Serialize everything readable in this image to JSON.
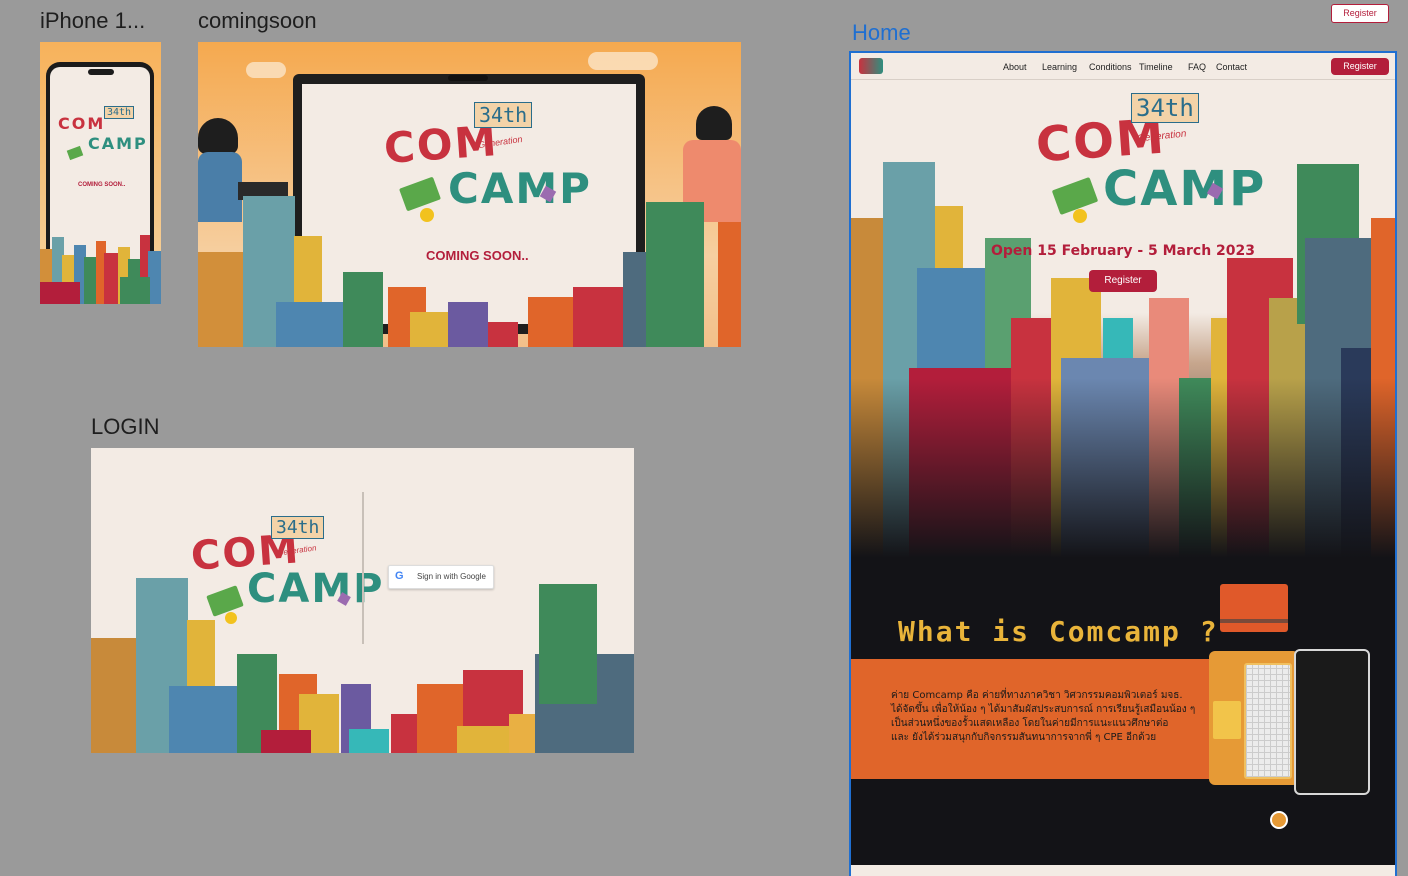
{
  "frames": {
    "iphone_label": "iPhone 1...",
    "comingsoon_label": "comingsoon",
    "login_label": "LOGIN",
    "home_label": "Home"
  },
  "logo": {
    "com": "COM",
    "camp": "CAMP",
    "gen_number": "34th",
    "generation": "Generation"
  },
  "iphone": {
    "coming_soon": "COMING SOON.."
  },
  "comingsoon": {
    "coming_soon": "COMING SOON.."
  },
  "login": {
    "google_button": "Sign in with Google"
  },
  "top_register": "Register",
  "home": {
    "nav": [
      "About",
      "Learning",
      "Conditions",
      "Timeline",
      "FAQ",
      "Contact"
    ],
    "nav_register": "Register",
    "open_dates": "Open 15 February -  5 March 2023",
    "hero_register": "Register",
    "what_title": "What is Comcamp ?",
    "what_text": [
      "ค่าย Comcamp คือ ค่ายที่ทางภาควิชา วิศวกรรมคอมพิวเตอร์ มจธ.",
      "ได้จัดขึ้น เพื่อให้น้อง ๆ ได้มาสัมผัสประสบการณ์ การเรียนรู้เสมือนน้อง ๆ",
      "เป็นส่วนหนึ่งของรั้วแสดเหลือง โดยในค่ายมีการแนะแนวศึกษาต่อ",
      "และ ยังได้ร่วมสนุกกับกิจกรรมสันทนาการจากพี่ ๆ CPE อีกด้วย"
    ]
  },
  "colors": {
    "brand_red": "#b31e3b",
    "teal": "#2e8f7f",
    "orange": "#e0652a",
    "gold": "#e9b43a",
    "cream": "#f3ebe4",
    "selection_blue": "#1f6fd1"
  },
  "icons": [
    "google-icon",
    "money-icon",
    "puzzle-icon",
    "coin-icon",
    "laptop-illustration",
    "city-skyline"
  ]
}
